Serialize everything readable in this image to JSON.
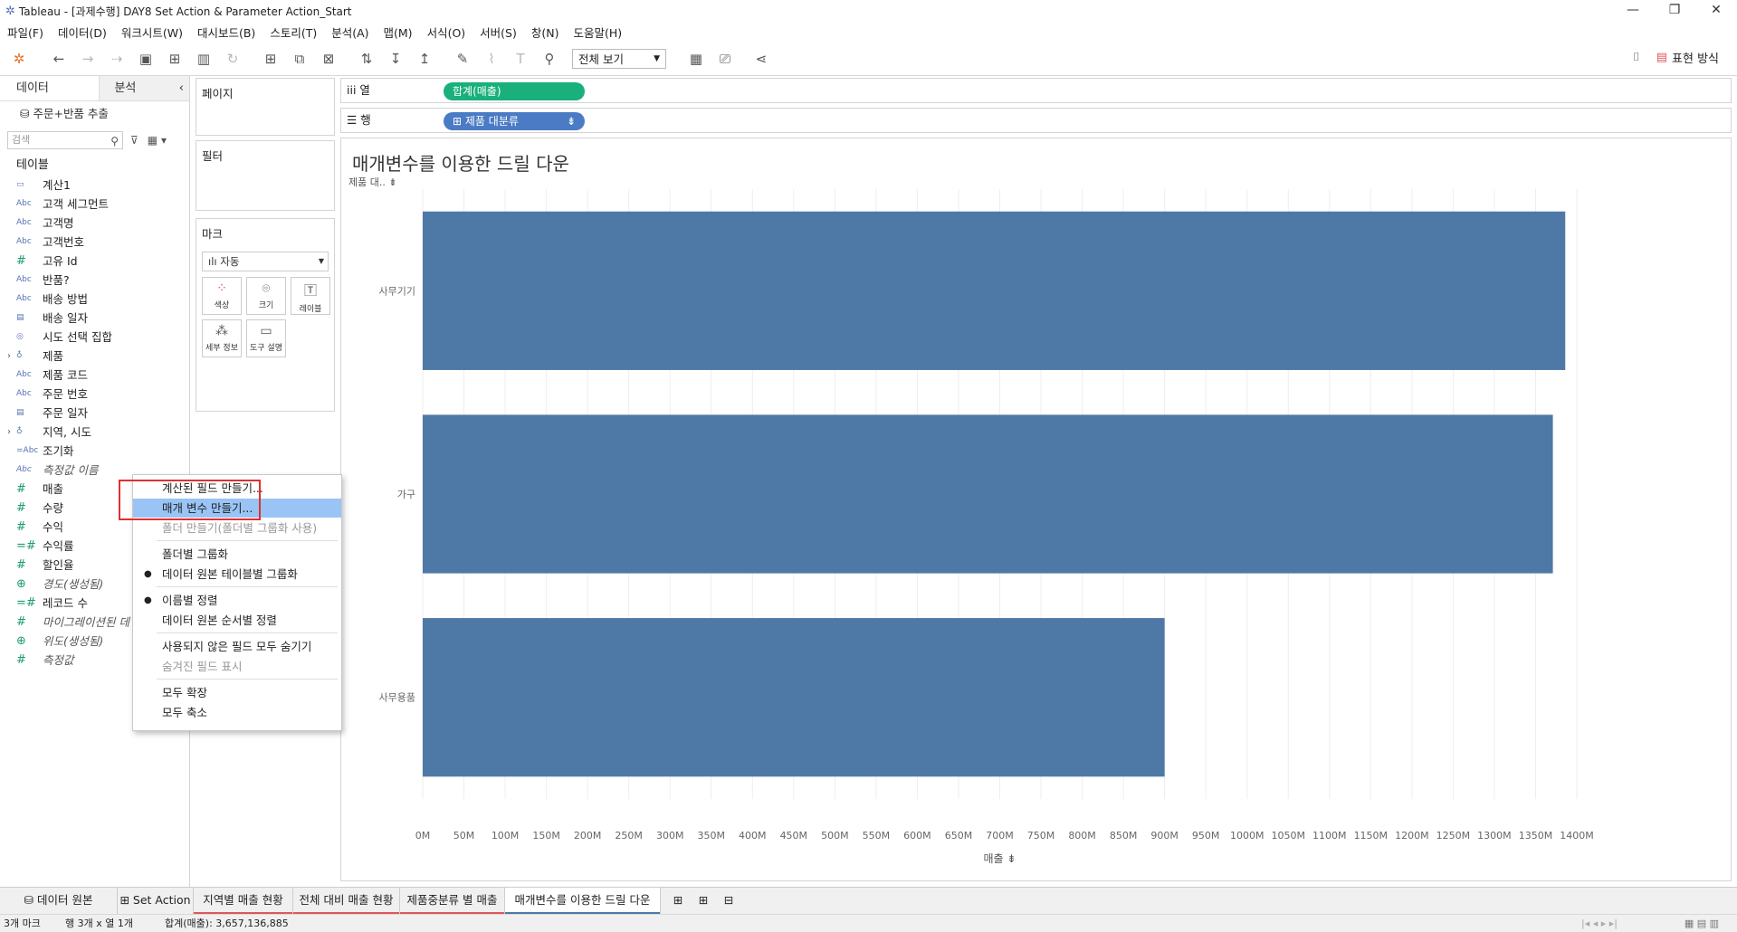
{
  "window": {
    "title": "Tableau - [과제수행] DAY8 Set Action & Parameter Action_Start"
  },
  "menu": [
    "파일(F)",
    "데이터(D)",
    "워크시트(W)",
    "대시보드(B)",
    "스토리(T)",
    "분석(A)",
    "맵(M)",
    "서식(O)",
    "서버(S)",
    "창(N)",
    "도움말(H)"
  ],
  "toolbar": {
    "view_select": "전체 보기",
    "show_me": "표현 방식"
  },
  "left_pane": {
    "tab_data": "데이터",
    "tab_analysis": "분석",
    "datasource": "주문+반품 추출",
    "search_placeholder": "검색",
    "tables_title": "테이블",
    "fields": [
      {
        "icon": "▭",
        "name": "계산1"
      },
      {
        "icon": "Abc",
        "name": "고객 세그먼트"
      },
      {
        "icon": "Abc",
        "name": "고객명"
      },
      {
        "icon": "Abc",
        "name": "고객번호"
      },
      {
        "icon": "#",
        "name": "고유 Id"
      },
      {
        "icon": "Abc",
        "name": "반품?"
      },
      {
        "icon": "Abc",
        "name": "배송 방법"
      },
      {
        "icon": "▤",
        "name": "배송 일자"
      },
      {
        "icon": "◎",
        "name": "시도 선택 집합"
      },
      {
        "icon": "♁",
        "name": "제품"
      },
      {
        "icon": "Abc",
        "name": "제품 코드"
      },
      {
        "icon": "Abc",
        "name": "주문 번호"
      },
      {
        "icon": "▤",
        "name": "주문 일자"
      },
      {
        "icon": "♁",
        "name": "지역, 시도"
      },
      {
        "icon": "=Abc",
        "name": "조기화"
      },
      {
        "icon": "Abc",
        "name": "측정값 이름"
      },
      {
        "icon": "#",
        "name": "매출"
      },
      {
        "icon": "#",
        "name": "수량"
      },
      {
        "icon": "#",
        "name": "수익"
      },
      {
        "icon": "=#",
        "name": "수익률"
      },
      {
        "icon": "#",
        "name": "할인율"
      },
      {
        "icon": "⊕",
        "name": "경도(생성됨)"
      },
      {
        "icon": "=#",
        "name": "레코드 수"
      },
      {
        "icon": "#",
        "name": "마이그레이션된 데"
      },
      {
        "icon": "⊕",
        "name": "위도(생성됨)"
      },
      {
        "icon": "#",
        "name": "측정값"
      }
    ]
  },
  "cards": {
    "pages": "페이지",
    "filters": "필터",
    "marks": "마크",
    "mark_type": "자동",
    "mark_buttons": [
      "색상",
      "크기",
      "레이블",
      "세부 정보",
      "도구 설명"
    ]
  },
  "shelves": {
    "columns_label": "열",
    "columns_pill": "합계(매출)",
    "rows_label": "행",
    "rows_pill": "제품 대분류"
  },
  "view": {
    "title": "매개변수를 이용한 드릴 다운",
    "row_header": "제품 대.."
  },
  "chart_data": {
    "type": "bar",
    "orientation": "horizontal",
    "categories": [
      "사무기기",
      "가구",
      "사무용품"
    ],
    "values": [
      1386000000,
      1371000000,
      900000000
    ],
    "xlim": [
      0,
      1400000000
    ],
    "xticks": [
      "0M",
      "50M",
      "100M",
      "150M",
      "200M",
      "250M",
      "300M",
      "350M",
      "400M",
      "450M",
      "500M",
      "550M",
      "600M",
      "650M",
      "700M",
      "750M",
      "800M",
      "850M",
      "900M",
      "950M",
      "1000M",
      "1050M",
      "1100M",
      "1150M",
      "1200M",
      "1250M",
      "1300M",
      "1350M",
      "1400M"
    ],
    "xlabel": "매출",
    "bar_color": "#4e79a7"
  },
  "context_menu": [
    {
      "label": "계산된 필드 만들기...",
      "disabled": false
    },
    {
      "label": "매개 변수 만들기...",
      "highlight": true
    },
    {
      "label": "폴더 만들기(폴더별 그룹화 사용)",
      "disabled": true
    },
    {
      "sep": true
    },
    {
      "label": "폴더별 그룹화"
    },
    {
      "label": "데이터 원본 테이블별 그룹화",
      "checked": true
    },
    {
      "sep": true
    },
    {
      "label": "이름별 정렬",
      "checked": true
    },
    {
      "label": "데이터 원본 순서별 정렬"
    },
    {
      "sep": true
    },
    {
      "label": "사용되지 않은 필드 모두 숨기기"
    },
    {
      "label": "숨겨진 필드 표시",
      "disabled": true
    },
    {
      "sep": true
    },
    {
      "label": "모두 확장"
    },
    {
      "label": "모두 축소"
    }
  ],
  "sheet_tabs": [
    {
      "label": "데이터 원본",
      "icon": "cylinder"
    },
    {
      "label": "Set Action",
      "icon": "grid"
    },
    {
      "label": "지역별 매출 현황",
      "underline": "#e15759"
    },
    {
      "label": "전체 대비 매출 현황",
      "underline": "#e15759"
    },
    {
      "label": "제품중분류 별 매출",
      "underline": "#e15759"
    },
    {
      "label": "매개변수를 이용한 드릴 다운",
      "underline": "#4e79a7",
      "active": true
    }
  ],
  "status": {
    "marks": "3개 마크",
    "rows_cols": "행 3개 x 열 1개",
    "sum": "합계(매출): 3,657,136,885"
  }
}
